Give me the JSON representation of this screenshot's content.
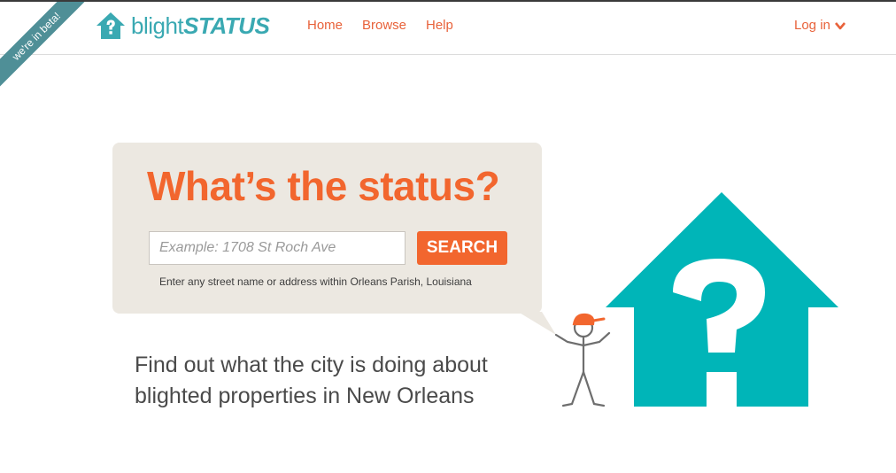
{
  "ribbon": {
    "text": "we're in beta!"
  },
  "brand": {
    "part1": "blight",
    "part2": "STATUS",
    "color": "#3aa9b2"
  },
  "nav": {
    "home": "Home",
    "browse": "Browse",
    "help": "Help",
    "login": "Log in"
  },
  "hero": {
    "headline": "What’s the status?",
    "search_placeholder": "Example: 1708 St Roch Ave",
    "search_button": "SEARCH",
    "hint": "Enter any street name or address within Orleans Parish, Louisiana",
    "tagline": "Find out what the city is doing about blighted properties in New Orleans"
  },
  "colors": {
    "accent": "#f2662e",
    "teal": "#00b5b8",
    "bubble": "#ece8e1"
  },
  "icons": {
    "logo": "house-question-icon",
    "login_arrow": "chevron-down-icon",
    "illustration": "stick-figure-shrug",
    "house": "house-question-icon"
  }
}
